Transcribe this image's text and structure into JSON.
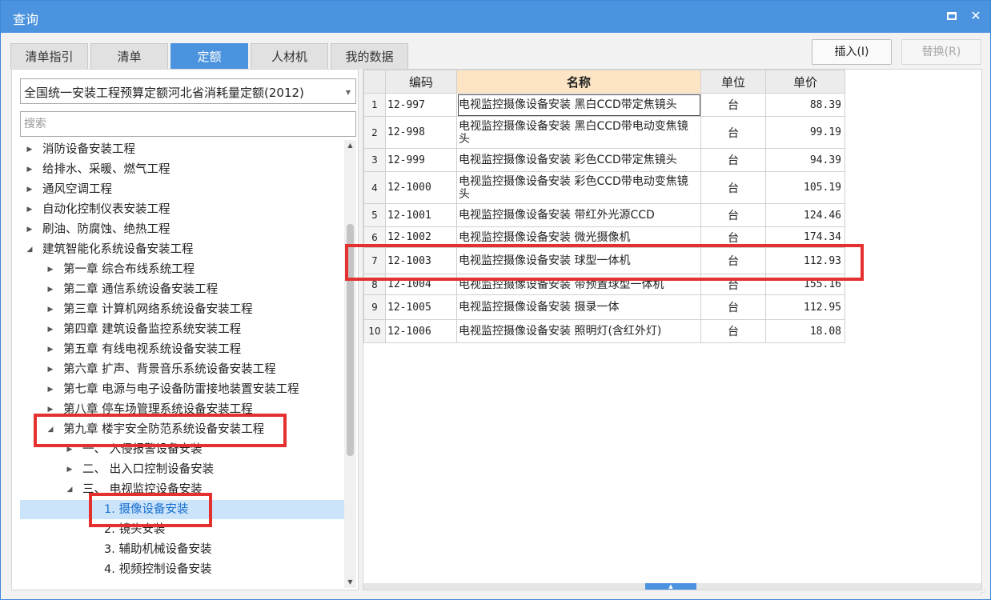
{
  "window": {
    "title": "查询"
  },
  "tabs": [
    {
      "label": "清单指引",
      "active": false
    },
    {
      "label": "清单",
      "active": false
    },
    {
      "label": "定额",
      "active": true
    },
    {
      "label": "人材机",
      "active": false
    },
    {
      "label": "我的数据",
      "active": false
    }
  ],
  "buttons": {
    "insert": "插入(I)",
    "replace": "替换(R)"
  },
  "quota_library": {
    "selected": "全国统一安装工程预算定额河北省消耗量定额(2012)"
  },
  "search": {
    "placeholder": "搜索",
    "value": ""
  },
  "tree": [
    {
      "label": "消防设备安装工程",
      "level": 0,
      "state": "collapsed"
    },
    {
      "label": "给排水、采暖、燃气工程",
      "level": 0,
      "state": "collapsed"
    },
    {
      "label": "通风空调工程",
      "level": 0,
      "state": "collapsed"
    },
    {
      "label": "自动化控制仪表安装工程",
      "level": 0,
      "state": "collapsed"
    },
    {
      "label": "刷油、防腐蚀、绝热工程",
      "level": 0,
      "state": "collapsed"
    },
    {
      "label": "建筑智能化系统设备安装工程",
      "level": 0,
      "state": "expanded"
    },
    {
      "label": "第一章 综合布线系统工程",
      "level": 1,
      "state": "collapsed"
    },
    {
      "label": "第二章 通信系统设备安装工程",
      "level": 1,
      "state": "collapsed"
    },
    {
      "label": "第三章 计算机网络系统设备安装工程",
      "level": 1,
      "state": "collapsed"
    },
    {
      "label": "第四章 建筑设备监控系统安装工程",
      "level": 1,
      "state": "collapsed"
    },
    {
      "label": "第五章 有线电视系统设备安装工程",
      "level": 1,
      "state": "collapsed"
    },
    {
      "label": "第六章 扩声、背景音乐系统设备安装工程",
      "level": 1,
      "state": "collapsed"
    },
    {
      "label": "第七章 电源与电子设备防雷接地装置安装工程",
      "level": 1,
      "state": "collapsed"
    },
    {
      "label": "第八章 停车场管理系统设备安装工程",
      "level": 1,
      "state": "collapsed"
    },
    {
      "label": "第九章 楼宇安全防范系统设备安装工程",
      "level": 1,
      "state": "expanded"
    },
    {
      "label": "一、 入侵报警设备安装",
      "level": 2,
      "state": "collapsed"
    },
    {
      "label": "二、 出入口控制设备安装",
      "level": 2,
      "state": "collapsed"
    },
    {
      "label": "三、 电视监控设备安装",
      "level": 2,
      "state": "expanded"
    },
    {
      "label": "1. 摄像设备安装",
      "level": 3,
      "state": "leaf",
      "selected": true
    },
    {
      "label": "2. 镜头安装",
      "level": 3,
      "state": "leaf"
    },
    {
      "label": "3. 辅助机械设备安装",
      "level": 3,
      "state": "leaf"
    },
    {
      "label": "4. 视频控制设备安装",
      "level": 3,
      "state": "leaf"
    }
  ],
  "table": {
    "columns": [
      "编码",
      "名称",
      "单位",
      "单价"
    ],
    "rows": [
      {
        "idx": "1",
        "code": "12-997",
        "name": "电视监控摄像设备安装 黑白CCD带定焦镜头",
        "unit": "台",
        "price": "88.39"
      },
      {
        "idx": "2",
        "code": "12-998",
        "name": "电视监控摄像设备安装 黑白CCD带电动变焦镜头",
        "unit": "台",
        "price": "99.19"
      },
      {
        "idx": "3",
        "code": "12-999",
        "name": "电视监控摄像设备安装 彩色CCD带定焦镜头",
        "unit": "台",
        "price": "94.39"
      },
      {
        "idx": "4",
        "code": "12-1000",
        "name": "电视监控摄像设备安装 彩色CCD带电动变焦镜头",
        "unit": "台",
        "price": "105.19"
      },
      {
        "idx": "5",
        "code": "12-1001",
        "name": "电视监控摄像设备安装 带红外光源CCD",
        "unit": "台",
        "price": "124.46"
      },
      {
        "idx": "6",
        "code": "12-1002",
        "name": "电视监控摄像设备安装 微光摄像机",
        "unit": "台",
        "price": "174.34"
      },
      {
        "idx": "7",
        "code": "12-1003",
        "name": "电视监控摄像设备安装 球型一体机",
        "unit": "台",
        "price": "112.93"
      },
      {
        "idx": "8",
        "code": "12-1004",
        "name": "电视监控摄像设备安装 带预置球型一体机",
        "unit": "台",
        "price": "155.16"
      },
      {
        "idx": "9",
        "code": "12-1005",
        "name": "电视监控摄像设备安装 摄录一体",
        "unit": "台",
        "price": "112.95"
      },
      {
        "idx": "10",
        "code": "12-1006",
        "name": "电视监控摄像设备安装 照明灯(含红外灯)",
        "unit": "台",
        "price": "18.08"
      }
    ]
  },
  "highlight_color": "#e53030",
  "accent_color": "#4b93de"
}
